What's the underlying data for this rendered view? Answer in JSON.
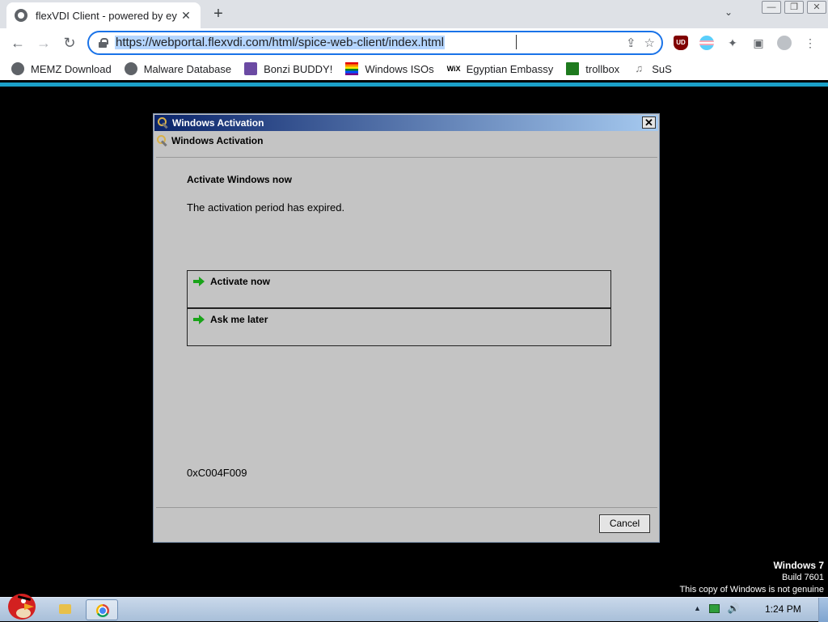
{
  "browser": {
    "tab_title": "flexVDI Client - powered by ey",
    "tab_close": "✕",
    "new_tab": "+",
    "tab_dropdown": "⌄",
    "window_buttons": [
      "—",
      "❐",
      "✕"
    ],
    "back": "←",
    "forward": "→",
    "reload": "↻",
    "url": "https://webportal.flexvdi.com/html/spice-web-client/index.html",
    "share_icon": "⇪",
    "star_icon": "☆",
    "extensions": [
      "uBlock Origin",
      "trans-flag",
      "puzzle",
      "side-panel",
      "profile",
      "menu"
    ],
    "ublock_text": "UD",
    "menu_icon": "⋮",
    "bookmarks": [
      {
        "label": "MEMZ Download",
        "icon": "globe-icon"
      },
      {
        "label": "Malware Database",
        "icon": "globe-icon"
      },
      {
        "label": "Bonzi BUDDY!",
        "icon": "bonzi-icon"
      },
      {
        "label": "Windows ISOs",
        "icon": "rainbow-flag-icon"
      },
      {
        "label": "Egyptian Embassy",
        "icon": "wix-icon"
      },
      {
        "label": "trollbox",
        "icon": "trollbox-icon"
      },
      {
        "label": "SuS",
        "icon": "sus-icon"
      }
    ],
    "wix_text": "WiX"
  },
  "dialog": {
    "window_title": "Windows Activation",
    "close": "✕",
    "header": "Windows Activation",
    "heading": "Activate Windows now",
    "message": "The activation period has expired.",
    "options": [
      "Activate now",
      "Ask me later"
    ],
    "error_code": "0xC004F009",
    "cancel_label": "Cancel"
  },
  "watermark": {
    "os": "Windows 7",
    "build": "Build 7601",
    "notice": "This copy of Windows is not genuine"
  },
  "taskbar": {
    "clock": "1:24 PM",
    "tray_up": "▲",
    "tray_volume": "🔊"
  },
  "colors": {
    "accent": "#1a73e8",
    "loadbar": "#1ba1c9",
    "dialog_bg": "#c4c4c4",
    "title_gradient_start": "#0a246a"
  }
}
